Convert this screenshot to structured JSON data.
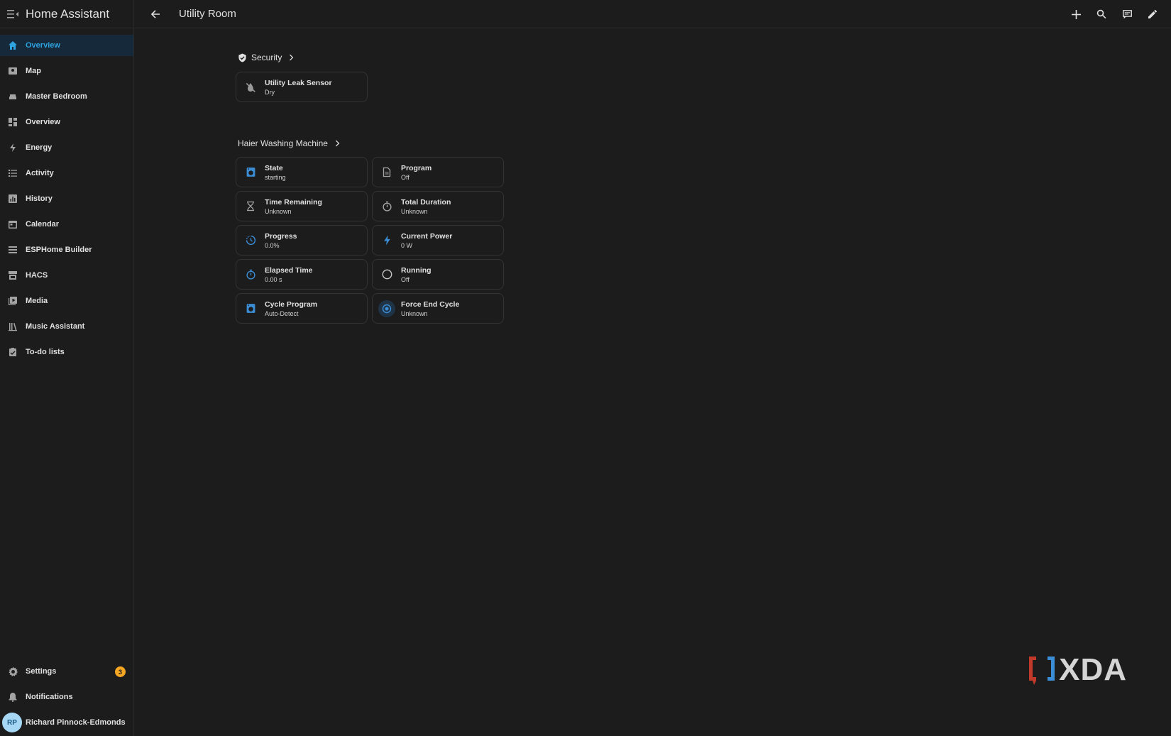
{
  "app": {
    "title": "Home Assistant"
  },
  "topbar": {
    "page_title": "Utility Room"
  },
  "sidebar": {
    "items": [
      {
        "label": "Overview",
        "icon": "home-icon",
        "active": true
      },
      {
        "label": "Map",
        "icon": "map-icon"
      },
      {
        "label": "Master Bedroom",
        "icon": "sofa-icon"
      },
      {
        "label": "Overview",
        "icon": "dashboard-icon"
      },
      {
        "label": "Energy",
        "icon": "lightning-icon"
      },
      {
        "label": "Activity",
        "icon": "list-icon"
      },
      {
        "label": "History",
        "icon": "chart-icon"
      },
      {
        "label": "Calendar",
        "icon": "calendar-icon"
      },
      {
        "label": "ESPHome Builder",
        "icon": "esphome-icon"
      },
      {
        "label": "HACS",
        "icon": "hacs-icon"
      },
      {
        "label": "Media",
        "icon": "media-icon"
      },
      {
        "label": "Music Assistant",
        "icon": "music-icon"
      },
      {
        "label": "To-do lists",
        "icon": "todo-icon"
      }
    ],
    "bottom": {
      "settings_label": "Settings",
      "settings_badge": "3",
      "notifications_label": "Notifications",
      "user_initials": "RP",
      "user_name": "Richard Pinnock-Edmonds"
    }
  },
  "sections": {
    "security": {
      "title": "Security",
      "tiles": [
        {
          "name": "Utility Leak Sensor",
          "state": "Dry"
        }
      ]
    },
    "washer": {
      "title": "Haier Washing Machine",
      "tiles": [
        {
          "name": "State",
          "state": "starting"
        },
        {
          "name": "Program",
          "state": "Off"
        },
        {
          "name": "Time Remaining",
          "state": "Unknown"
        },
        {
          "name": "Total Duration",
          "state": "Unknown"
        },
        {
          "name": "Progress",
          "state": "0.0%"
        },
        {
          "name": "Current Power",
          "state": "0 W"
        },
        {
          "name": "Elapsed Time",
          "state": "0.00 s"
        },
        {
          "name": "Running",
          "state": "Off"
        },
        {
          "name": "Cycle Program",
          "state": "Auto-Detect"
        },
        {
          "name": "Force End Cycle",
          "state": "Unknown"
        }
      ]
    }
  },
  "watermark": {
    "text": "XDA"
  },
  "colors": {
    "accent": "#2ea3e0",
    "badge": "#f5a623",
    "background": "#1c1c1c"
  }
}
